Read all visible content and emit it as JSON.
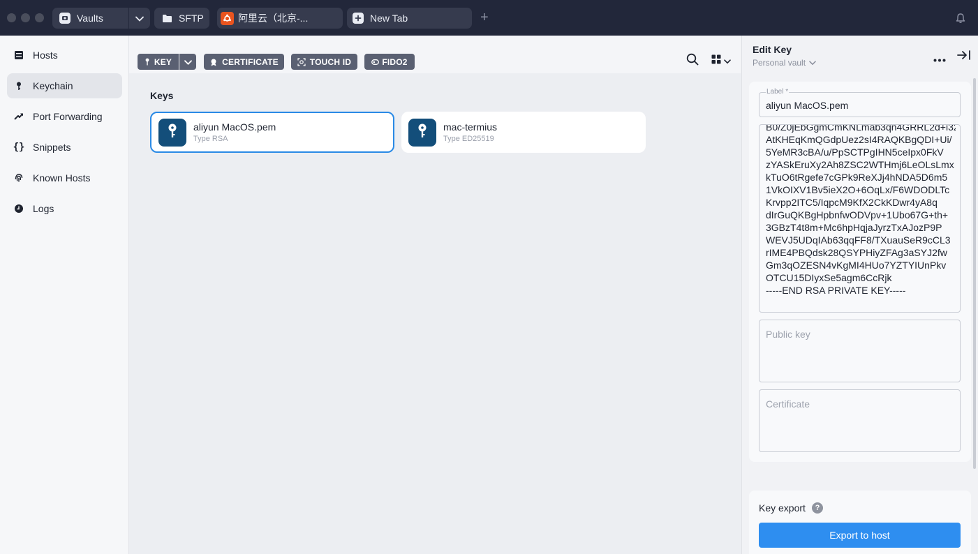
{
  "titlebar": {
    "tabs": [
      {
        "label": "Vaults",
        "icon": "vault-icon"
      },
      {
        "label": "SFTP",
        "icon": "folder-icon"
      },
      {
        "label": "阿里云（北京-...",
        "icon": "ubuntu-icon"
      },
      {
        "label": "New Tab",
        "icon": "plus-square-icon"
      }
    ],
    "new_tab_symbol": "+"
  },
  "sidebar": {
    "items": [
      {
        "label": "Hosts",
        "icon": "hosts-icon"
      },
      {
        "label": "Keychain",
        "icon": "key-icon",
        "active": true
      },
      {
        "label": "Port Forwarding",
        "icon": "port-forwarding-icon"
      },
      {
        "label": "Snippets",
        "icon": "braces-icon"
      },
      {
        "label": "Known Hosts",
        "icon": "fingerprint-icon"
      },
      {
        "label": "Logs",
        "icon": "clock-icon"
      }
    ]
  },
  "toolbar": {
    "key_label": "KEY",
    "certificate_label": "CERTIFICATE",
    "touchid_label": "TOUCH ID",
    "fido2_label": "FIDO2"
  },
  "keys": {
    "title": "Keys",
    "items": [
      {
        "name": "aliyun MacOS.pem",
        "type": "Type RSA",
        "selected": true
      },
      {
        "name": "mac-termius",
        "type": "Type ED25519",
        "selected": false
      }
    ]
  },
  "panel": {
    "title": "Edit Key",
    "vault": "Personal vault",
    "label_field": {
      "label": "Label *",
      "value": "aliyun MacOS.pem"
    },
    "private_key_lines": [
      "B0/Z0jEbGgmCmKNLmab3qn4GRRL2d+i32",
      "AtKHEqKmQGdpUez2sI4RAQKBgQDI+Ui/",
      "5YeMR3cBA/u/PpSCTPgIHN5ceIpx0FkV",
      "zYASkEruXy2Ah8ZSC2WTHmj6LeOLsLmx",
      "kTuO6tRgefe7cGPk9ReXJj4hNDA5D6m5",
      "1VkOIXV1Bv5ieX2O+6OqLx/F6WDODLTc",
      "Krvpp2ITC5/IqpcM9KfX2CkKDwr4yA8q",
      "dIrGuQKBgHpbnfwODVpv+1Ubo67G+th+",
      "3GBzT4t8m+Mc6hpHqjaJyrzTxAJozP9P",
      "WEVJ5UDqIAb63qqFF8/TXuauSeR9cCL3",
      "rIME4PBQdsk28QSYPHiyZFAg3aSYJ2fw",
      "Gm3qOZESN4vKgMI4HUo7YZTYIUnPkv",
      "OTCU15DIyxSe5agm6CcRjk",
      "-----END RSA PRIVATE KEY-----"
    ],
    "public_key_placeholder": "Public key",
    "certificate_placeholder": "Certificate",
    "key_export_label": "Key export",
    "help_symbol": "?",
    "export_button": "Export to host"
  },
  "colors": {
    "accent": "#2e8ef0",
    "titlebar": "#22273a",
    "key_avatar": "#134e7a",
    "toolbar_button": "#5a6072"
  }
}
